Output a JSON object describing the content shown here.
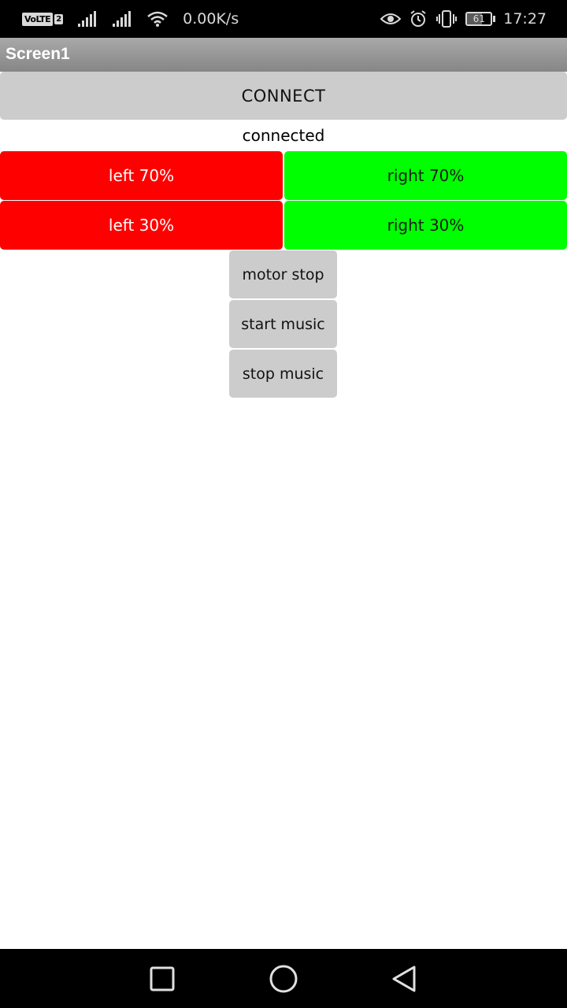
{
  "status_bar": {
    "volte_label": "VoLTE",
    "sim_index": "2",
    "net_speed": "0.00K/s",
    "battery_level": "61",
    "time": "17:27",
    "icons": [
      "volte-icon",
      "signal-icon",
      "signal-icon",
      "wifi-icon",
      "eye-icon",
      "alarm-icon",
      "vibrate-icon",
      "battery-icon"
    ]
  },
  "app": {
    "title": "Screen1"
  },
  "main": {
    "connect_label": "CONNECT",
    "status_text": "connected",
    "left_70_label": "left 70%",
    "right_70_label": "right 70%",
    "left_30_label": "left 30%",
    "right_30_label": "right 30%",
    "motor_stop_label": "motor stop",
    "start_music_label": "start music",
    "stop_music_label": "stop music"
  },
  "colors": {
    "left_buttons": "#ff0000",
    "right_buttons": "#00ff00",
    "gray_buttons": "#cccccc",
    "title_bar": "#969696"
  },
  "nav_bar": {
    "icons": [
      "recent-apps-icon",
      "home-icon",
      "back-icon"
    ]
  }
}
